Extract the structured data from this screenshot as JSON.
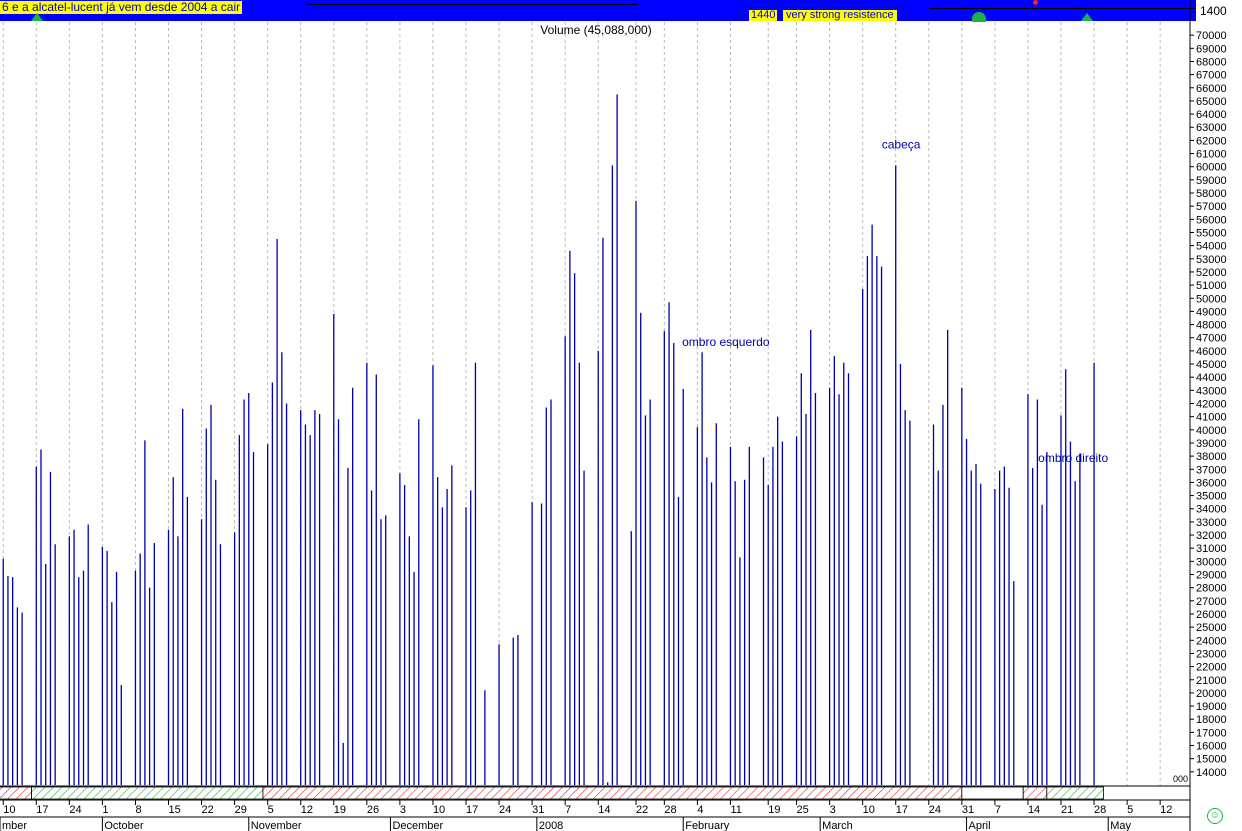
{
  "header": {
    "annotation_left": "6 e a alcatel-lucent já vem desde 2004 a cair",
    "annotation_level": "1440",
    "annotation_resistance": "very strong resistence",
    "upper_scale_label": "1400"
  },
  "chart_data": {
    "type": "bar",
    "title": "Volume (45,088,000)",
    "ylim": [
      13000,
      71000
    ],
    "y_ticks": [
      14000,
      15000,
      16000,
      17000,
      18000,
      19000,
      20000,
      21000,
      22000,
      23000,
      24000,
      25000,
      26000,
      27000,
      28000,
      29000,
      30000,
      31000,
      32000,
      33000,
      34000,
      35000,
      36000,
      37000,
      38000,
      39000,
      40000,
      41000,
      42000,
      43000,
      44000,
      45000,
      46000,
      47000,
      48000,
      49000,
      50000,
      51000,
      52000,
      53000,
      54000,
      55000,
      56000,
      57000,
      58000,
      59000,
      60000,
      61000,
      62000,
      63000,
      64000,
      65000,
      66000,
      67000,
      68000,
      69000,
      70000
    ],
    "y_tick_labels": [
      "14000",
      "15000",
      "16000",
      "17000",
      "18000",
      "19000",
      "20000",
      "21000",
      "22000",
      "23000",
      "24000",
      "25000",
      "26000",
      "27000",
      "28000",
      "29000",
      "30000",
      "31000",
      "32000",
      "33000",
      "34000",
      "35000",
      "36000",
      "37000",
      "38000",
      "39000",
      "40000",
      "41000",
      "42000",
      "43000",
      "44000",
      "45000",
      "46000",
      "47000",
      "48000",
      "49000",
      "50000",
      "51000",
      "52000",
      "53000",
      "54000",
      "55000",
      "56000",
      "57000",
      "58000",
      "59000",
      "60000",
      "61000",
      "62000",
      "63000",
      "64000",
      "65000",
      "66000",
      "67000",
      "68000",
      "69000",
      "70000"
    ],
    "bottom_axis_stub": "000",
    "grid": true,
    "bar_color": "#0000aa",
    "days": [
      {
        "d": "2007-09-10",
        "v": 30200
      },
      {
        "d": "2007-09-11",
        "v": 28900
      },
      {
        "d": "2007-09-12",
        "v": 28800
      },
      {
        "d": "2007-09-13",
        "v": 26500
      },
      {
        "d": "2007-09-14",
        "v": 26100
      },
      {
        "d": "2007-09-17",
        "v": 37200
      },
      {
        "d": "2007-09-18",
        "v": 38500
      },
      {
        "d": "2007-09-19",
        "v": 29800
      },
      {
        "d": "2007-09-20",
        "v": 36800
      },
      {
        "d": "2007-09-21",
        "v": 31300
      },
      {
        "d": "2007-09-24",
        "v": 31900
      },
      {
        "d": "2007-09-25",
        "v": 32400
      },
      {
        "d": "2007-09-26",
        "v": 28800
      },
      {
        "d": "2007-09-27",
        "v": 29300
      },
      {
        "d": "2007-09-28",
        "v": 32800
      },
      {
        "d": "2007-10-01",
        "v": 31100
      },
      {
        "d": "2007-10-02",
        "v": 30800
      },
      {
        "d": "2007-10-03",
        "v": 26900
      },
      {
        "d": "2007-10-04",
        "v": 29200
      },
      {
        "d": "2007-10-05",
        "v": 20600
      },
      {
        "d": "2007-10-08",
        "v": 29300
      },
      {
        "d": "2007-10-09",
        "v": 30600
      },
      {
        "d": "2007-10-10",
        "v": 39200
      },
      {
        "d": "2007-10-11",
        "v": 28000
      },
      {
        "d": "2007-10-12",
        "v": 31400
      },
      {
        "d": "2007-10-15",
        "v": 32400
      },
      {
        "d": "2007-10-16",
        "v": 36400
      },
      {
        "d": "2007-10-17",
        "v": 31900
      },
      {
        "d": "2007-10-18",
        "v": 41600
      },
      {
        "d": "2007-10-19",
        "v": 34900
      },
      {
        "d": "2007-10-22",
        "v": 33200
      },
      {
        "d": "2007-10-23",
        "v": 40100
      },
      {
        "d": "2007-10-24",
        "v": 41900
      },
      {
        "d": "2007-10-25",
        "v": 36200
      },
      {
        "d": "2007-10-26",
        "v": 31300
      },
      {
        "d": "2007-10-29",
        "v": 32200
      },
      {
        "d": "2007-10-30",
        "v": 39600
      },
      {
        "d": "2007-10-31",
        "v": 42300
      },
      {
        "d": "2007-11-01",
        "v": 42800
      },
      {
        "d": "2007-11-02",
        "v": 38300
      },
      {
        "d": "2007-11-05",
        "v": 38900
      },
      {
        "d": "2007-11-06",
        "v": 43600
      },
      {
        "d": "2007-11-07",
        "v": 54500
      },
      {
        "d": "2007-11-08",
        "v": 45900
      },
      {
        "d": "2007-11-09",
        "v": 42000
      },
      {
        "d": "2007-11-12",
        "v": 41500
      },
      {
        "d": "2007-11-13",
        "v": 40400
      },
      {
        "d": "2007-11-14",
        "v": 39600
      },
      {
        "d": "2007-11-15",
        "v": 41500
      },
      {
        "d": "2007-11-16",
        "v": 41200
      },
      {
        "d": "2007-11-19",
        "v": 48800
      },
      {
        "d": "2007-11-20",
        "v": 40800
      },
      {
        "d": "2007-11-21",
        "v": 16200
      },
      {
        "d": "2007-11-22",
        "v": 37100
      },
      {
        "d": "2007-11-23",
        "v": 43200
      },
      {
        "d": "2007-11-26",
        "v": 45100
      },
      {
        "d": "2007-11-27",
        "v": 35400
      },
      {
        "d": "2007-11-28",
        "v": 44200
      },
      {
        "d": "2007-11-29",
        "v": 33200
      },
      {
        "d": "2007-11-30",
        "v": 33500
      },
      {
        "d": "2007-12-03",
        "v": 36700
      },
      {
        "d": "2007-12-04",
        "v": 35800
      },
      {
        "d": "2007-12-05",
        "v": 31900
      },
      {
        "d": "2007-12-06",
        "v": 29200
      },
      {
        "d": "2007-12-07",
        "v": 40800
      },
      {
        "d": "2007-12-10",
        "v": 44900
      },
      {
        "d": "2007-12-11",
        "v": 36400
      },
      {
        "d": "2007-12-12",
        "v": 34100
      },
      {
        "d": "2007-12-13",
        "v": 35500
      },
      {
        "d": "2007-12-14",
        "v": 37300
      },
      {
        "d": "2007-12-17",
        "v": 34100
      },
      {
        "d": "2007-12-18",
        "v": 35400
      },
      {
        "d": "2007-12-19",
        "v": 45100
      },
      {
        "d": "2007-12-21",
        "v": 20200
      },
      {
        "d": "2007-12-24",
        "v": 23700
      },
      {
        "d": "2007-12-27",
        "v": 24200
      },
      {
        "d": "2007-12-28",
        "v": 24400
      },
      {
        "d": "2007-12-31",
        "v": 34500
      },
      {
        "d": "2008-01-02",
        "v": 34400
      },
      {
        "d": "2008-01-03",
        "v": 41700
      },
      {
        "d": "2008-01-04",
        "v": 42300
      },
      {
        "d": "2008-01-07",
        "v": 47100
      },
      {
        "d": "2008-01-08",
        "v": 53600
      },
      {
        "d": "2008-01-09",
        "v": 51900
      },
      {
        "d": "2008-01-10",
        "v": 45100
      },
      {
        "d": "2008-01-11",
        "v": 36900
      },
      {
        "d": "2008-01-14",
        "v": 46000
      },
      {
        "d": "2008-01-15",
        "v": 54600
      },
      {
        "d": "2008-01-16",
        "v": 13200
      },
      {
        "d": "2008-01-17",
        "v": 60100
      },
      {
        "d": "2008-01-18",
        "v": 65500
      },
      {
        "d": "2008-01-21",
        "v": 32300
      },
      {
        "d": "2008-01-22",
        "v": 57400
      },
      {
        "d": "2008-01-23",
        "v": 48900
      },
      {
        "d": "2008-01-24",
        "v": 41100
      },
      {
        "d": "2008-01-25",
        "v": 42300
      },
      {
        "d": "2008-01-28",
        "v": 47500
      },
      {
        "d": "2008-01-29",
        "v": 49700
      },
      {
        "d": "2008-01-30",
        "v": 46600
      },
      {
        "d": "2008-01-31",
        "v": 34900
      },
      {
        "d": "2008-02-01",
        "v": 43100
      },
      {
        "d": "2008-02-04",
        "v": 40200
      },
      {
        "d": "2008-02-05",
        "v": 45900
      },
      {
        "d": "2008-02-06",
        "v": 37900
      },
      {
        "d": "2008-02-07",
        "v": 36000
      },
      {
        "d": "2008-02-08",
        "v": 40500
      },
      {
        "d": "2008-02-11",
        "v": 38700
      },
      {
        "d": "2008-02-12",
        "v": 36100
      },
      {
        "d": "2008-02-13",
        "v": 30300
      },
      {
        "d": "2008-02-14",
        "v": 36200
      },
      {
        "d": "2008-02-15",
        "v": 38700
      },
      {
        "d": "2008-02-18",
        "v": 37900
      },
      {
        "d": "2008-02-19",
        "v": 35800
      },
      {
        "d": "2008-02-20",
        "v": 38700
      },
      {
        "d": "2008-02-21",
        "v": 41000
      },
      {
        "d": "2008-02-22",
        "v": 39100
      },
      {
        "d": "2008-02-25",
        "v": 39500
      },
      {
        "d": "2008-02-26",
        "v": 44300
      },
      {
        "d": "2008-02-27",
        "v": 41200
      },
      {
        "d": "2008-02-28",
        "v": 47600
      },
      {
        "d": "2008-02-29",
        "v": 42800
      },
      {
        "d": "2008-03-03",
        "v": 43200
      },
      {
        "d": "2008-03-04",
        "v": 45600
      },
      {
        "d": "2008-03-05",
        "v": 42700
      },
      {
        "d": "2008-03-06",
        "v": 45100
      },
      {
        "d": "2008-03-07",
        "v": 44300
      },
      {
        "d": "2008-03-10",
        "v": 50700
      },
      {
        "d": "2008-03-11",
        "v": 53200
      },
      {
        "d": "2008-03-12",
        "v": 55600
      },
      {
        "d": "2008-03-13",
        "v": 53200
      },
      {
        "d": "2008-03-14",
        "v": 52400
      },
      {
        "d": "2008-03-17",
        "v": 60100
      },
      {
        "d": "2008-03-18",
        "v": 45000
      },
      {
        "d": "2008-03-19",
        "v": 41500
      },
      {
        "d": "2008-03-20",
        "v": 40700
      },
      {
        "d": "2008-03-25",
        "v": 40400
      },
      {
        "d": "2008-03-26",
        "v": 36900
      },
      {
        "d": "2008-03-27",
        "v": 41900
      },
      {
        "d": "2008-03-28",
        "v": 47600
      },
      {
        "d": "2008-03-31",
        "v": 43200
      },
      {
        "d": "2008-04-01",
        "v": 39300
      },
      {
        "d": "2008-04-02",
        "v": 36900
      },
      {
        "d": "2008-04-03",
        "v": 37400
      },
      {
        "d": "2008-04-04",
        "v": 35900
      },
      {
        "d": "2008-04-07",
        "v": 35500
      },
      {
        "d": "2008-04-08",
        "v": 36900
      },
      {
        "d": "2008-04-09",
        "v": 37200
      },
      {
        "d": "2008-04-10",
        "v": 35600
      },
      {
        "d": "2008-04-11",
        "v": 28500
      },
      {
        "d": "2008-04-14",
        "v": 42700
      },
      {
        "d": "2008-04-15",
        "v": 37100
      },
      {
        "d": "2008-04-16",
        "v": 42300
      },
      {
        "d": "2008-04-17",
        "v": 34300
      },
      {
        "d": "2008-04-18",
        "v": 38300
      },
      {
        "d": "2008-04-21",
        "v": 41100
      },
      {
        "d": "2008-04-22",
        "v": 44600
      },
      {
        "d": "2008-04-23",
        "v": 39100
      },
      {
        "d": "2008-04-24",
        "v": 36100
      },
      {
        "d": "2008-04-25",
        "v": 38200
      },
      {
        "d": "2008-04-28",
        "v": 45100
      }
    ],
    "annotations": [
      {
        "text": "ombro esquerdo",
        "anchor_date": "2008-02-05"
      },
      {
        "text": "cabeça",
        "anchor_date": "2008-03-17"
      },
      {
        "text": "ombro direito",
        "anchor_date": "2008-04-24"
      }
    ],
    "x_tick_labels": [
      {
        "text": "10",
        "d": "2007-09-10"
      },
      {
        "text": "17",
        "d": "2007-09-17"
      },
      {
        "text": "24",
        "d": "2007-09-24"
      },
      {
        "text": "1",
        "d": "2007-10-01"
      },
      {
        "text": "8",
        "d": "2007-10-08"
      },
      {
        "text": "15",
        "d": "2007-10-15"
      },
      {
        "text": "22",
        "d": "2007-10-22"
      },
      {
        "text": "29",
        "d": "2007-10-29"
      },
      {
        "text": "5",
        "d": "2007-11-05"
      },
      {
        "text": "12",
        "d": "2007-11-12"
      },
      {
        "text": "19",
        "d": "2007-11-19"
      },
      {
        "text": "26",
        "d": "2007-11-26"
      },
      {
        "text": "3",
        "d": "2007-12-03"
      },
      {
        "text": "10",
        "d": "2007-12-10"
      },
      {
        "text": "17",
        "d": "2007-12-17"
      },
      {
        "text": "24",
        "d": "2007-12-24"
      },
      {
        "text": "31",
        "d": "2007-12-31"
      },
      {
        "text": "7",
        "d": "2008-01-07"
      },
      {
        "text": "14",
        "d": "2008-01-14"
      },
      {
        "text": "22",
        "d": "2008-01-22"
      },
      {
        "text": "28",
        "d": "2008-01-28"
      },
      {
        "text": "4",
        "d": "2008-02-04"
      },
      {
        "text": "11",
        "d": "2008-02-11"
      },
      {
        "text": "19",
        "d": "2008-02-19"
      },
      {
        "text": "25",
        "d": "2008-02-25"
      },
      {
        "text": "3",
        "d": "2008-03-03"
      },
      {
        "text": "10",
        "d": "2008-03-10"
      },
      {
        "text": "17",
        "d": "2008-03-17"
      },
      {
        "text": "24",
        "d": "2008-03-24"
      },
      {
        "text": "31",
        "d": "2008-03-31"
      },
      {
        "text": "7",
        "d": "2008-04-07"
      },
      {
        "text": "14",
        "d": "2008-04-14"
      },
      {
        "text": "21",
        "d": "2008-04-21"
      },
      {
        "text": "28",
        "d": "2008-04-28"
      },
      {
        "text": "5",
        "d": "2008-05-05"
      },
      {
        "text": "12",
        "d": "2008-05-12"
      }
    ],
    "month_labels": [
      {
        "text": "mber",
        "d": "2007-09-10"
      },
      {
        "text": "October",
        "d": "2007-10-01"
      },
      {
        "text": "November",
        "d": "2007-11-01"
      },
      {
        "text": "December",
        "d": "2007-12-01"
      },
      {
        "text": "2008",
        "d": "2008-01-01"
      },
      {
        "text": "February",
        "d": "2008-02-01"
      },
      {
        "text": "March",
        "d": "2008-03-01"
      },
      {
        "text": "April",
        "d": "2008-04-01"
      },
      {
        "text": "May",
        "d": "2008-05-01"
      }
    ],
    "x_range": [
      "2007-09-09",
      "2008-05-18"
    ],
    "band_segments": [
      {
        "from": "2007-09-09",
        "to": "2007-09-16",
        "style": "red"
      },
      {
        "from": "2007-09-16",
        "to": "2007-11-04",
        "style": "green"
      },
      {
        "from": "2007-11-04",
        "to": "2008-03-31",
        "style": "red"
      },
      {
        "from": "2008-03-31",
        "to": "2008-04-13",
        "style": "white"
      },
      {
        "from": "2008-04-13",
        "to": "2008-04-18",
        "style": "red"
      },
      {
        "from": "2008-04-18",
        "to": "2008-04-30",
        "style": "green"
      }
    ]
  }
}
